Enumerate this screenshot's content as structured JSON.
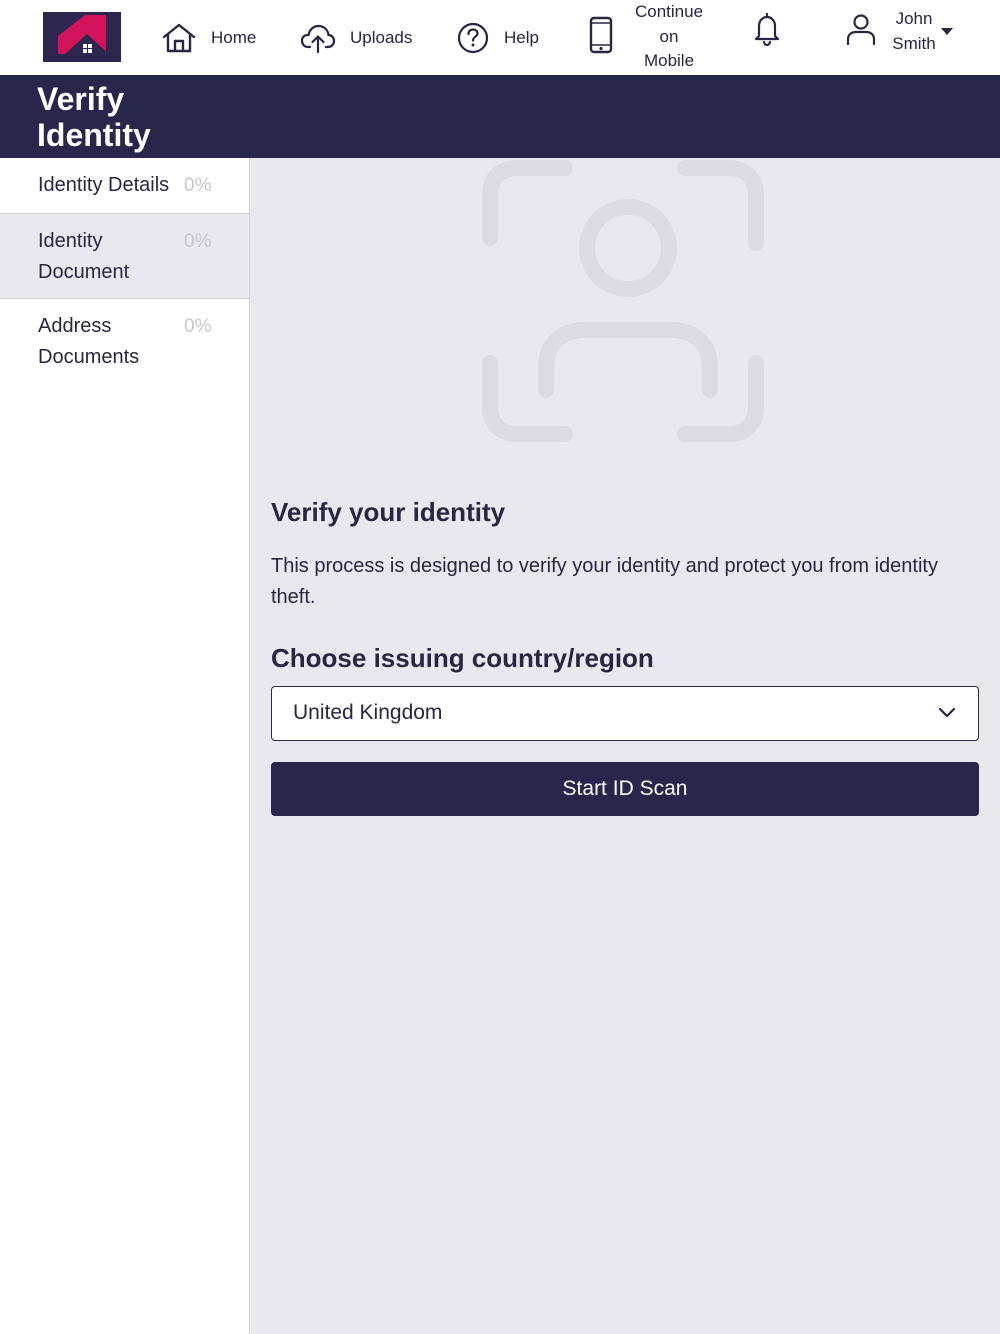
{
  "nav": {
    "home": "Home",
    "uploads": "Uploads",
    "help": "Help",
    "continue_mobile": [
      "Continue",
      "on",
      "Mobile"
    ],
    "user_name": [
      "John",
      "Smith"
    ]
  },
  "header": {
    "title": "Verify Identity"
  },
  "sidebar": {
    "items": [
      {
        "label": "Identity Details",
        "progress": "0%"
      },
      {
        "label": "Identity Document",
        "progress": "0%"
      },
      {
        "label": "Address Documents",
        "progress": "0%"
      }
    ]
  },
  "main": {
    "title": "Verify your identity",
    "description": "This process is designed to verify your identity and protect you from identity theft.",
    "country_label": "Choose issuing country/region",
    "country_value": "United Kingdom",
    "start_button": "Start ID Scan"
  },
  "colors": {
    "brand_dark": "#28264a",
    "logo_pink": "#d4145a",
    "background": "#e9e8ee"
  }
}
